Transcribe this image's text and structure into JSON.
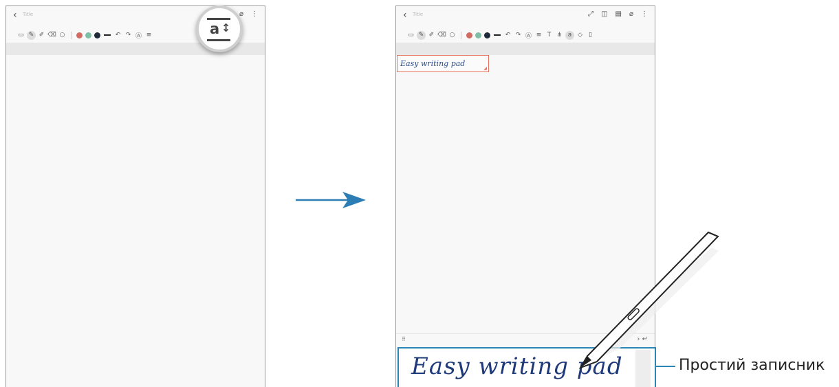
{
  "screens": {
    "left": {
      "back_icon": "chevron-left-icon",
      "title": "Title",
      "top_icons": [
        "expand-icon",
        "attach-icon",
        "more-icon"
      ],
      "magnified_icon": "text-size-icon"
    },
    "right": {
      "back_icon": "chevron-left-icon",
      "title": "Title",
      "top_icons": [
        "expand-icon",
        "book-icon",
        "page-icon",
        "attach-icon",
        "more-icon"
      ],
      "note_text": "Easy writing pad",
      "pad_text": "Easy writing pad"
    }
  },
  "toolbar": {
    "colors": [
      "#d46b62",
      "#7fbfa8",
      "#1f2b3a"
    ]
  },
  "arrow_color": "#2b7db3",
  "callout": {
    "label": "Простий записник",
    "color": "#2b86b5"
  }
}
